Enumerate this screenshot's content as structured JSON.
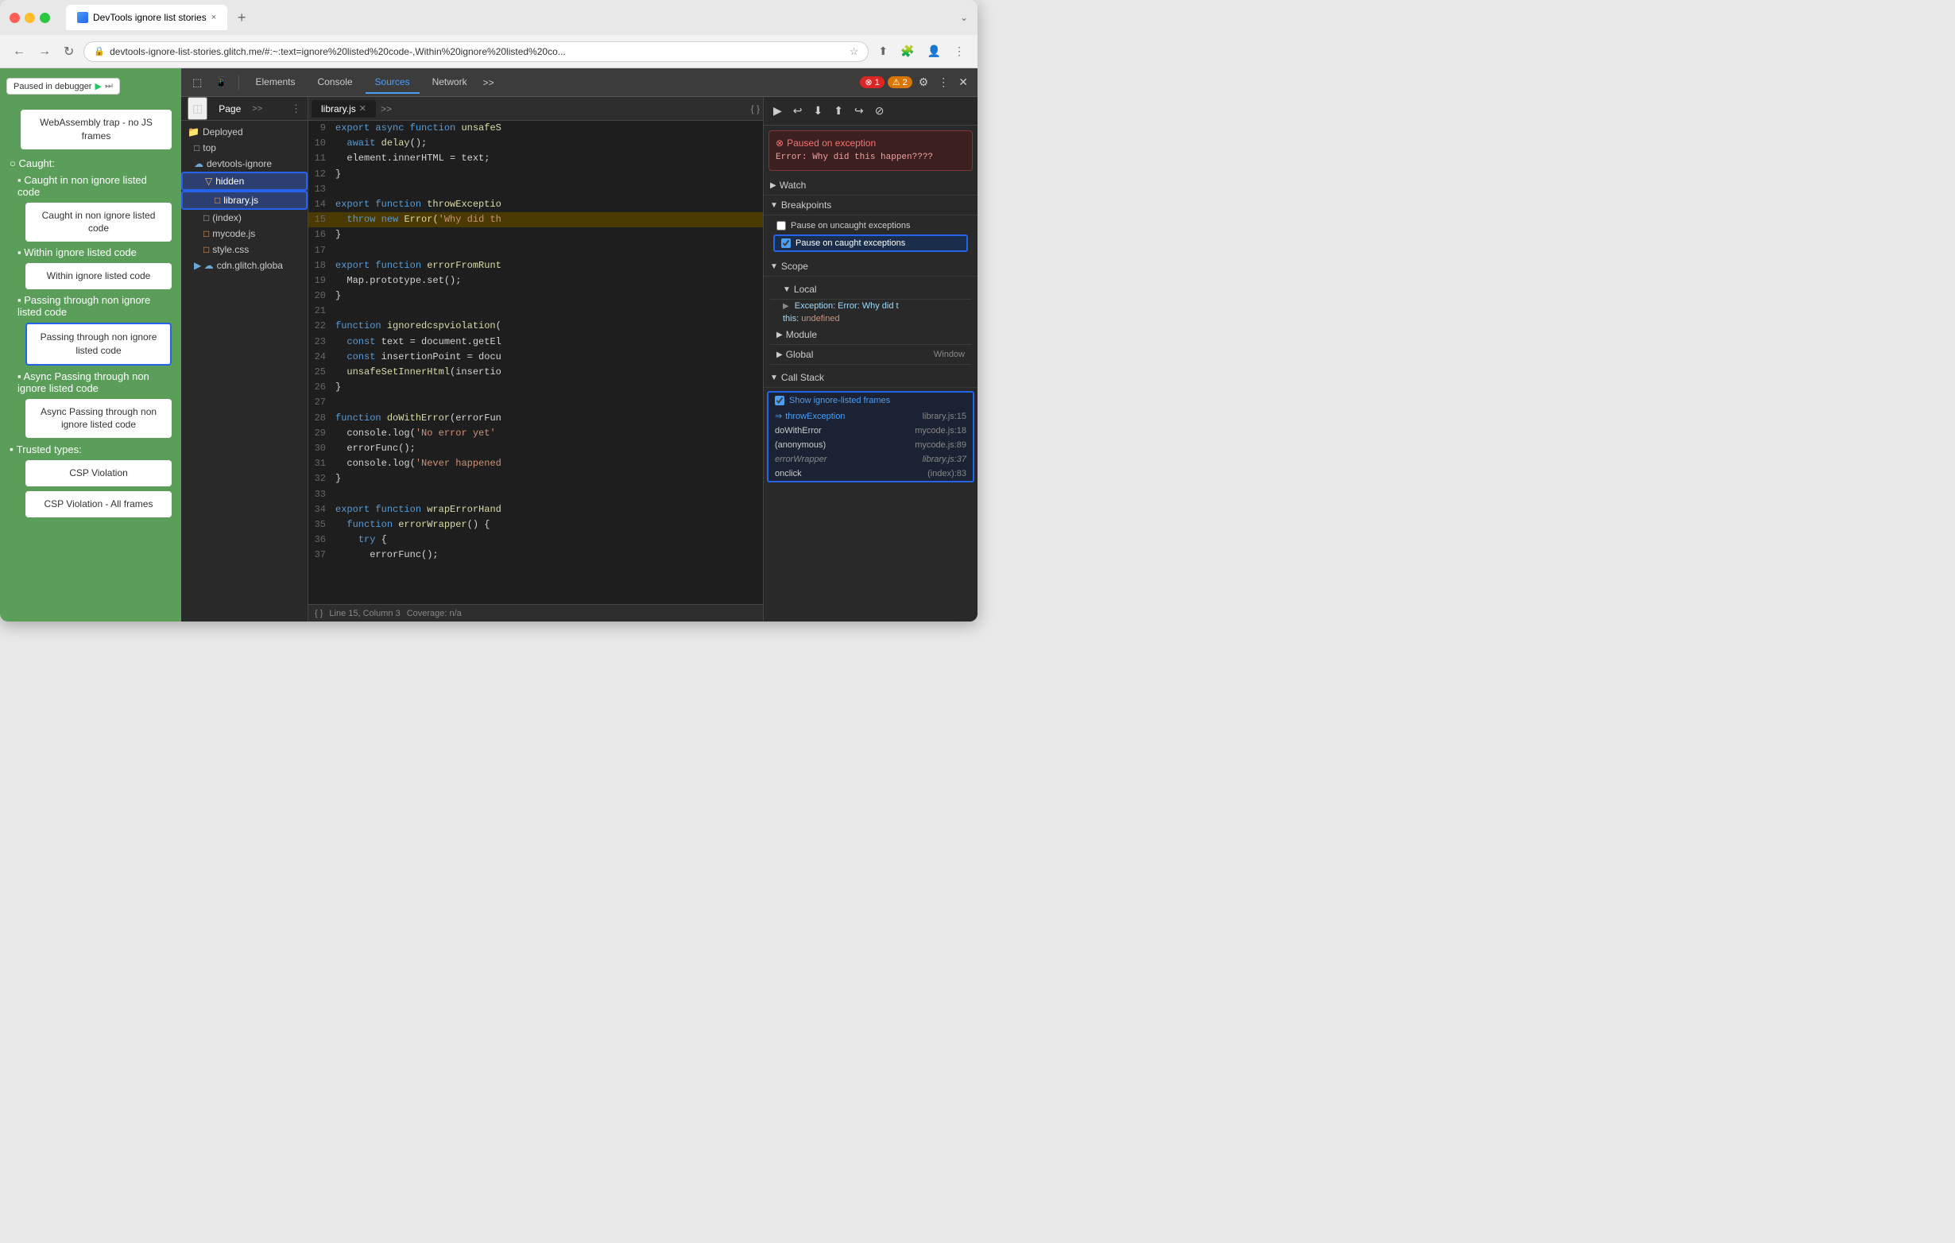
{
  "browser": {
    "tab_title": "DevTools ignore list stories",
    "tab_close": "×",
    "new_tab": "+",
    "overflow": "⌄",
    "back": "←",
    "forward": "→",
    "reload": "↻",
    "address": "devtools-ignore-list-stories.glitch.me/#:~:text=ignore%20listed%20code-,Within%20ignore%20listed%20co...",
    "lock_icon": "🔒"
  },
  "paused_badge": {
    "text": "Paused in debugger",
    "play": "▶",
    "skip": "⏭"
  },
  "webpage": {
    "webassembly_label": "WebAssembly trap - no JS frames",
    "caught_label": "Caught:",
    "caught_items": [
      "Caught in non ignore listed code",
      "Within ignore listed code",
      "Passing through non ignore listed code",
      "Async Passing through non ignore listed code"
    ],
    "trusted_types_label": "Trusted types:",
    "trusted_items": [
      "CSP Violation",
      "CSP Violation - All frames"
    ],
    "btn_caught_non_ignore": "Caught in non ignore listed code",
    "btn_within_ignore": "Within ignore listed code",
    "btn_passing_through": "Passing through non ignore listed code",
    "btn_passing_through_selected": true,
    "btn_async_passing": "Async Passing through non ignore listed code",
    "btn_csp": "CSP Violation",
    "btn_csp_all": "CSP Violation - All frames"
  },
  "devtools": {
    "toolbar_btns": [
      "⚙",
      "☰"
    ],
    "tabs": [
      "Elements",
      "Console",
      "Sources",
      "Network",
      ">>"
    ],
    "active_tab": "Sources",
    "error_count": "1",
    "warning_count": "2",
    "close": "✕",
    "file_panel": {
      "tabs": [
        "Page",
        ">>"
      ],
      "active_tab": "Page",
      "menu_icon": "⋮",
      "sidebar_toggle": "◫",
      "items": [
        {
          "label": "Deployed",
          "indent": 0,
          "type": "header"
        },
        {
          "label": "top",
          "indent": 1,
          "type": "folder"
        },
        {
          "label": "devtools-ignore",
          "indent": 1,
          "type": "cloud",
          "expanded": true
        },
        {
          "label": "hidden",
          "indent": 2,
          "type": "folder",
          "highlighted": true
        },
        {
          "label": "library.js",
          "indent": 3,
          "type": "file",
          "highlighted": true
        },
        {
          "label": "(index)",
          "indent": 2,
          "type": "file"
        },
        {
          "label": "mycode.js",
          "indent": 2,
          "type": "file"
        },
        {
          "label": "style.css",
          "indent": 2,
          "type": "file"
        },
        {
          "label": "cdn.glitch.globa",
          "indent": 1,
          "type": "cloud"
        }
      ]
    },
    "code_editor": {
      "active_file": "library.js",
      "lines": [
        {
          "num": 9,
          "content": "export async function unsafeS",
          "class": ""
        },
        {
          "num": 10,
          "content": "  await delay();",
          "class": ""
        },
        {
          "num": 11,
          "content": "  element.innerHTML = text;",
          "class": ""
        },
        {
          "num": 12,
          "content": "}",
          "class": ""
        },
        {
          "num": 13,
          "content": "",
          "class": ""
        },
        {
          "num": 14,
          "content": "export function throwExceptio",
          "class": ""
        },
        {
          "num": 15,
          "content": "  throw new Error('Why did th",
          "class": "highlighted"
        },
        {
          "num": 16,
          "content": "}",
          "class": ""
        },
        {
          "num": 17,
          "content": "",
          "class": ""
        },
        {
          "num": 18,
          "content": "export function errorFromRunt",
          "class": ""
        },
        {
          "num": 19,
          "content": "  Map.prototype.set();",
          "class": ""
        },
        {
          "num": 20,
          "content": "}",
          "class": ""
        },
        {
          "num": 21,
          "content": "",
          "class": ""
        },
        {
          "num": 22,
          "content": "function ignoredcspviolation(",
          "class": ""
        },
        {
          "num": 23,
          "content": "  const text = document.getEl",
          "class": ""
        },
        {
          "num": 24,
          "content": "  const insertionPoint = docu",
          "class": ""
        },
        {
          "num": 25,
          "content": "  unsafeSetInnerHtml(insertio",
          "class": ""
        },
        {
          "num": 26,
          "content": "}",
          "class": ""
        },
        {
          "num": 27,
          "content": "",
          "class": ""
        },
        {
          "num": 28,
          "content": "function doWithError(errorFun",
          "class": ""
        },
        {
          "num": 29,
          "content": "  console.log('No error yet'",
          "class": ""
        },
        {
          "num": 30,
          "content": "  errorFunc();",
          "class": ""
        },
        {
          "num": 31,
          "content": "  console.log('Never happened",
          "class": ""
        },
        {
          "num": 32,
          "content": "}",
          "class": ""
        },
        {
          "num": 33,
          "content": "",
          "class": ""
        },
        {
          "num": 34,
          "content": "export function wrapErrorHand",
          "class": ""
        },
        {
          "num": 35,
          "content": "  function errorWrapper() {",
          "class": ""
        },
        {
          "num": 36,
          "content": "    try {",
          "class": ""
        },
        {
          "num": 37,
          "content": "      errorFunc();",
          "class": ""
        }
      ],
      "status_bar": {
        "line_col": "Line 15, Column 3",
        "coverage": "Coverage: n/a"
      }
    },
    "right_panel": {
      "debugger_btns": [
        "▶",
        "↩",
        "⬇",
        "⬆",
        "↪",
        "⊘"
      ],
      "exception": {
        "title": "Paused on exception",
        "icon": "⊗",
        "message": "Error: Why did this\nhappen????"
      },
      "sections": {
        "watch": "Watch",
        "breakpoints": "Breakpoints",
        "breakpoint_items": [
          {
            "label": "Pause on uncaught exceptions",
            "checked": false
          },
          {
            "label": "Pause on caught exceptions",
            "checked": true,
            "highlighted": true
          }
        ],
        "scope": "Scope",
        "scope_local": "Local",
        "scope_items": [
          {
            "key": "► Exception: Error: Why did t",
            "val": "",
            "indent": 1
          },
          {
            "key": "this:",
            "val": "undefined",
            "indent": 1
          }
        ],
        "module": "Module",
        "global": "Global",
        "global_val": "Window",
        "call_stack": "Call Stack",
        "show_ignore_frames": "Show ignore-listed frames",
        "show_ignore_checked": true,
        "stack_frames": [
          {
            "fn": "throwException",
            "loc": "library.js:15",
            "type": "current",
            "ignore": true
          },
          {
            "fn": "doWithError",
            "loc": "mycode.js:18",
            "type": "normal"
          },
          {
            "fn": "(anonymous)",
            "loc": "mycode.js:89",
            "type": "normal"
          },
          {
            "fn": "errorWrapper",
            "loc": "library.js:37",
            "type": "ignore"
          },
          {
            "fn": "onclick",
            "loc": "(index):83",
            "type": "normal"
          }
        ]
      }
    }
  },
  "icons": {
    "cursor": "⬝",
    "inspect": "⬚",
    "play": "▶",
    "pause": "⏸",
    "step_over": "↩",
    "step_into": "⬇",
    "step_out": "⬆",
    "deactivate": "⊘",
    "settings": "⚙",
    "more": "⋮",
    "close": "✕",
    "error": "⊗",
    "warning": "⚠",
    "expand": "▶",
    "collapse": "▼"
  }
}
